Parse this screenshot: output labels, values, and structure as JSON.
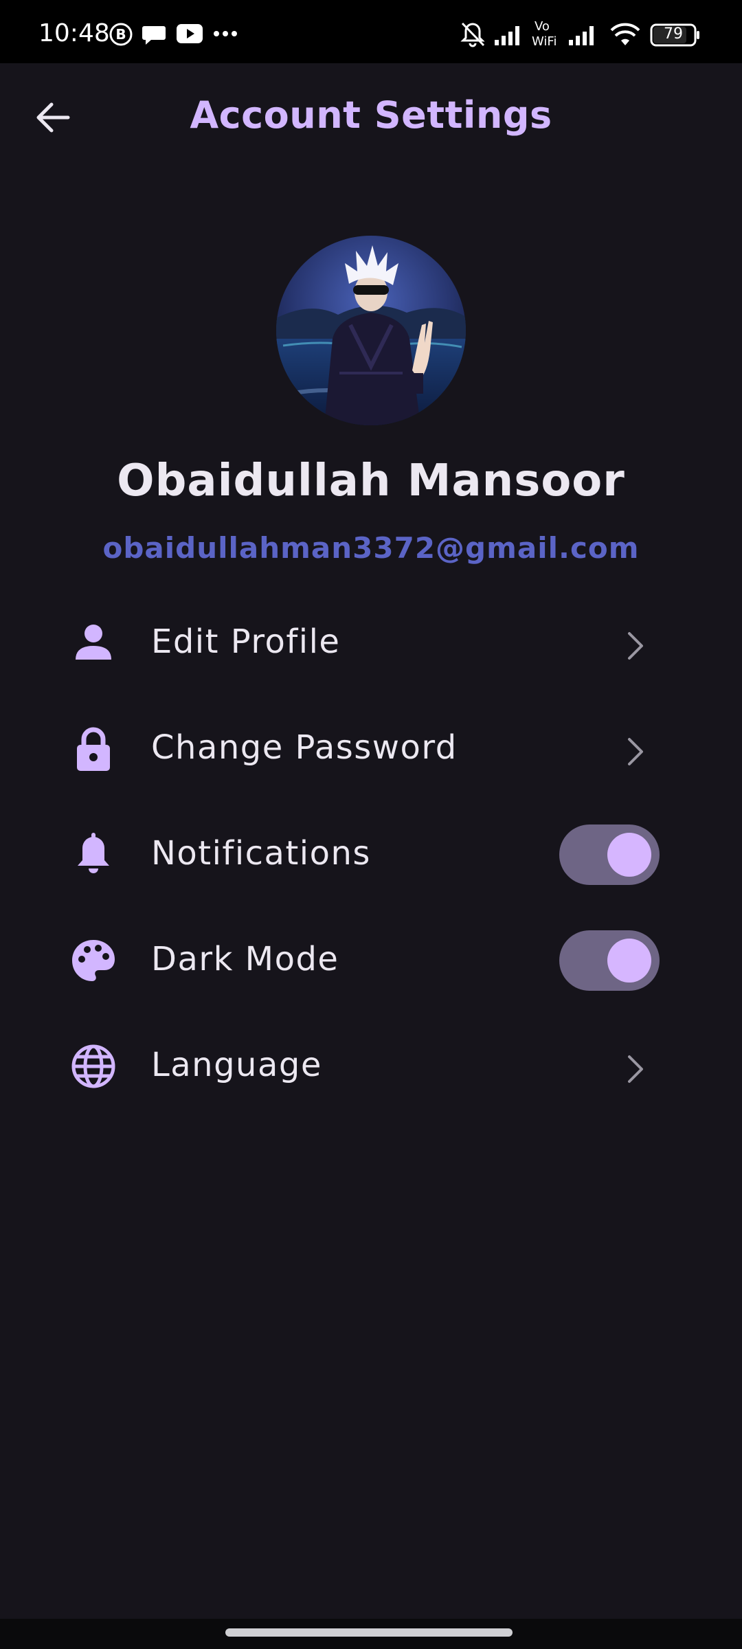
{
  "status_bar": {
    "time": "10:48",
    "battery": "79",
    "icons": [
      "b-badge-icon",
      "chat-bubble-icon",
      "youtube-icon",
      "more-dots-icon",
      "mute-bell-icon",
      "signal-icon",
      "vowifi-icon",
      "signal-icon",
      "wifi-icon",
      "battery-icon"
    ]
  },
  "header": {
    "title": "Account Settings",
    "back_icon": "arrow-back-icon"
  },
  "profile": {
    "name": "Obaidullah Mansoor",
    "email": "obaidullahman3372@gmail.com"
  },
  "settings": [
    {
      "label": "Edit Profile",
      "icon": "person-icon",
      "control": "chevron"
    },
    {
      "label": "Change Password",
      "icon": "lock-icon",
      "control": "chevron"
    },
    {
      "label": "Notifications",
      "icon": "bell-icon",
      "control": "toggle",
      "on": true
    },
    {
      "label": "Dark Mode",
      "icon": "palette-icon",
      "control": "toggle",
      "on": true
    },
    {
      "label": "Language",
      "icon": "globe-icon",
      "control": "chevron"
    }
  ],
  "colors": {
    "background": "#16141b",
    "accent": "#d2b6ff",
    "email": "#5b64c6",
    "text": "#ece8f1",
    "toggle_track": "#6e6585",
    "toggle_knob": "#d6b6ff"
  }
}
